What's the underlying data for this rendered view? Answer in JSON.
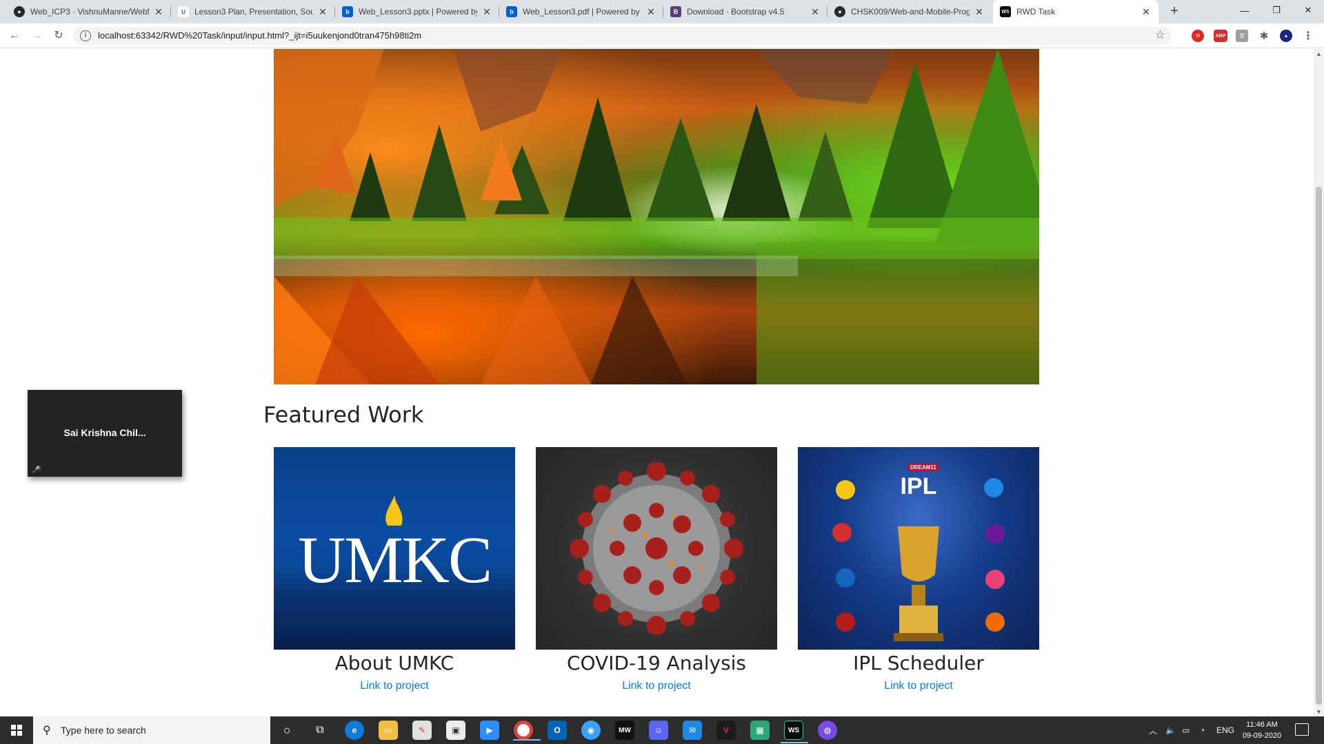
{
  "browser": {
    "tabs": [
      {
        "title": "Web_ICP3 · VishnuManne/WebM",
        "icon": "github-icon"
      },
      {
        "title": "Lesson3 Plan, Presentation, Sourc",
        "icon": "umkc-icon"
      },
      {
        "title": "Web_Lesson3.pptx | Powered by",
        "icon": "box-icon"
      },
      {
        "title": "Web_Lesson3.pdf | Powered by B",
        "icon": "box-icon"
      },
      {
        "title": "Download · Bootstrap v4.5",
        "icon": "bootstrap-icon"
      },
      {
        "title": "CHSK009/Web-and-Mobile-Prog",
        "icon": "github-icon"
      },
      {
        "title": "RWD Task",
        "icon": "webstorm-icon"
      }
    ],
    "url": "localhost:63342/RWD%20Task/input/input.html?_ijt=i5uukenjond0tran475h98ti2m",
    "extension_labels": {
      "abp": "ABP"
    }
  },
  "page": {
    "section_title": "Featured Work",
    "projects": [
      {
        "title": "About UMKC",
        "link": "Link to project",
        "image_text": "UMKC"
      },
      {
        "title": "COVID-19 Analysis",
        "link": "Link to project"
      },
      {
        "title": "IPL Scheduler",
        "link": "Link to project",
        "image_text": "IPL",
        "image_subtext": "DREAM11"
      }
    ]
  },
  "video_tile": {
    "name": "Sai Krishna Chil..."
  },
  "taskbar": {
    "search_placeholder": "Type here to search",
    "language": "ENG",
    "time": "11:46 AM",
    "date": "09-09-2020"
  },
  "colors": {
    "link": "#007bff",
    "taskbar": "#2c2c2c",
    "tabstrip": "#dee1e6"
  }
}
